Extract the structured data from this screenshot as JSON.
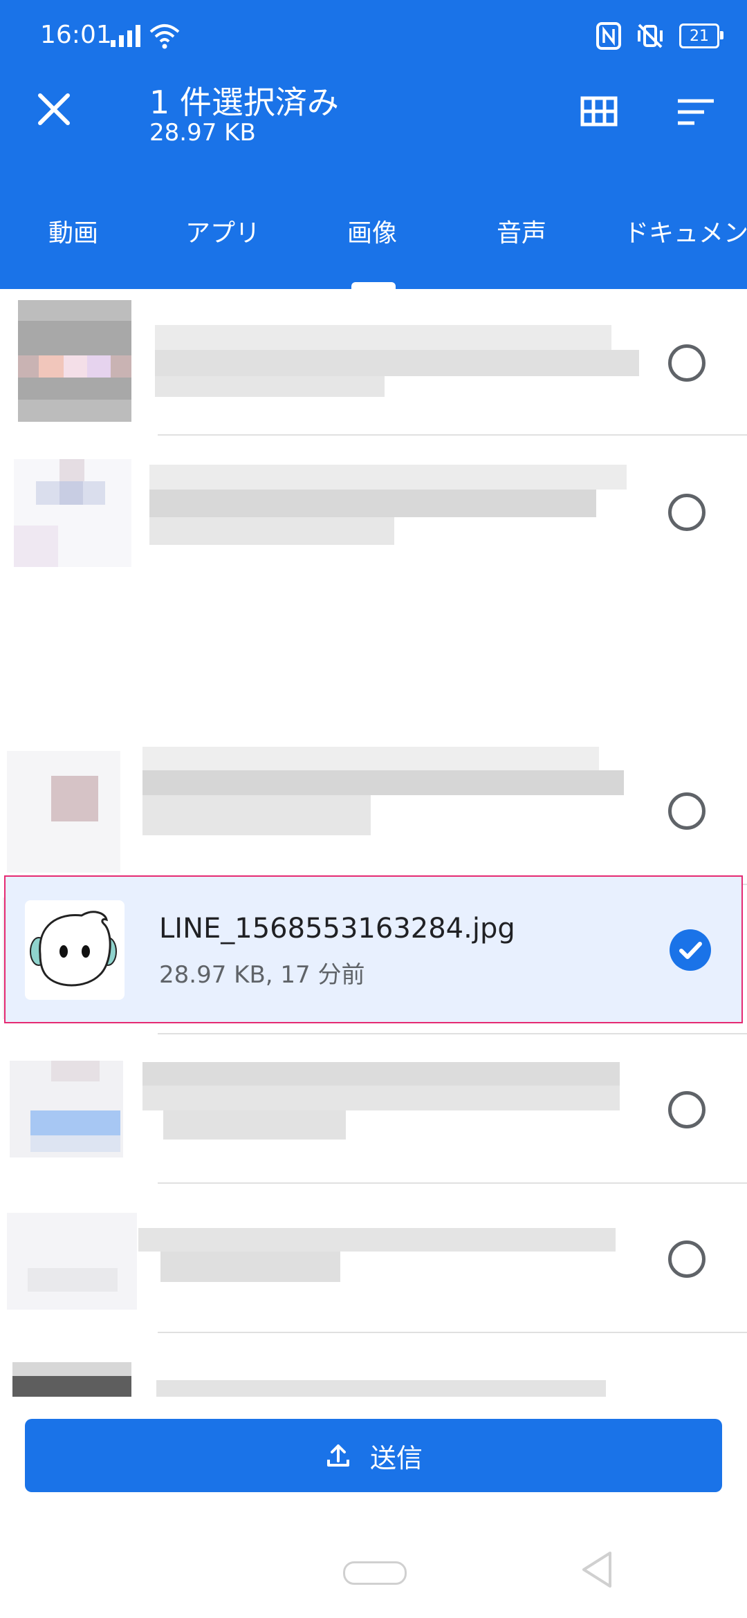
{
  "status_bar": {
    "time": "16:01",
    "battery": "21"
  },
  "header": {
    "title": "1 件選択済み",
    "subtitle": "28.97 KB"
  },
  "tabs": [
    "動画",
    "アプリ",
    "画像",
    "音声",
    "ドキュメン"
  ],
  "active_tab": "画像",
  "selected_item": {
    "name": "LINE_1568553163284.jpg",
    "meta": "28.97 KB, 17 分前",
    "checked": true
  },
  "send_button": {
    "label": "送信"
  },
  "colors": {
    "primary": "#1a73e8",
    "selected_bg": "#e8f0fe",
    "highlight_border": "#e52a72"
  }
}
